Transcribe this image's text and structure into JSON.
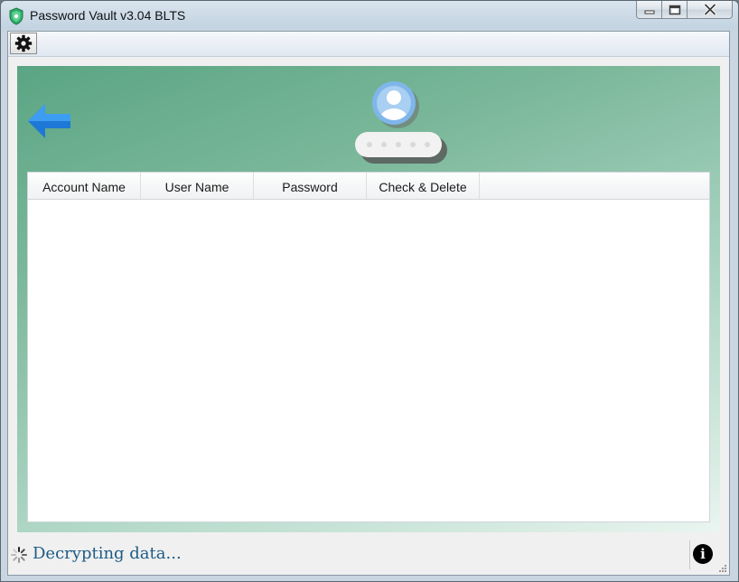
{
  "window": {
    "title": "Password Vault v3.04 BLTS"
  },
  "toolbar": {
    "settings_icon": "gear-icon"
  },
  "header": {
    "back_icon": "back-arrow-icon",
    "avatar_icon": "user-avatar-icon",
    "password_icon": "password-field-icon"
  },
  "table": {
    "columns": [
      "Account Name",
      "User Name",
      "Password",
      "Check & Delete"
    ],
    "rows": []
  },
  "status": {
    "text": "Decrypting data...",
    "info_icon": "info-icon"
  },
  "colors": {
    "accent_green": "#5aa583",
    "arrow_blue": "#2f8fe6",
    "status_text": "#1e5b86"
  }
}
